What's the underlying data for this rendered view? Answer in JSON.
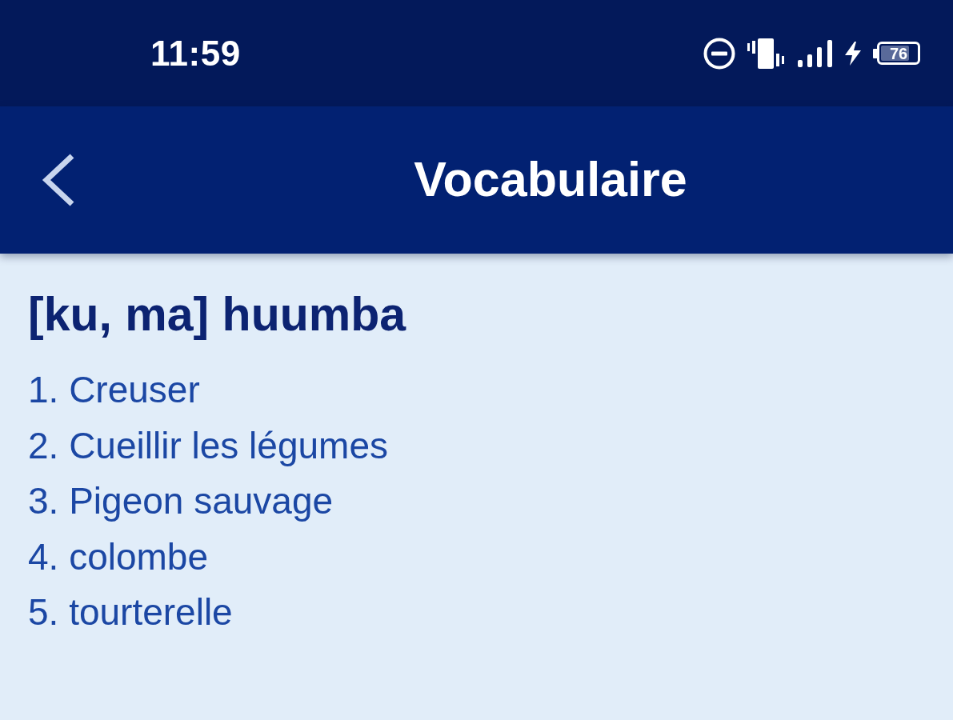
{
  "status_bar": {
    "time": "11:59",
    "battery": "76"
  },
  "app_bar": {
    "title": "Vocabulaire"
  },
  "entry": {
    "headword": "[ku, ma] huumba",
    "meanings": [
      "1. Creuser",
      "2. Cueillir les légumes",
      "3. Pigeon sauvage",
      "4. colombe",
      "5. tourterelle"
    ]
  }
}
